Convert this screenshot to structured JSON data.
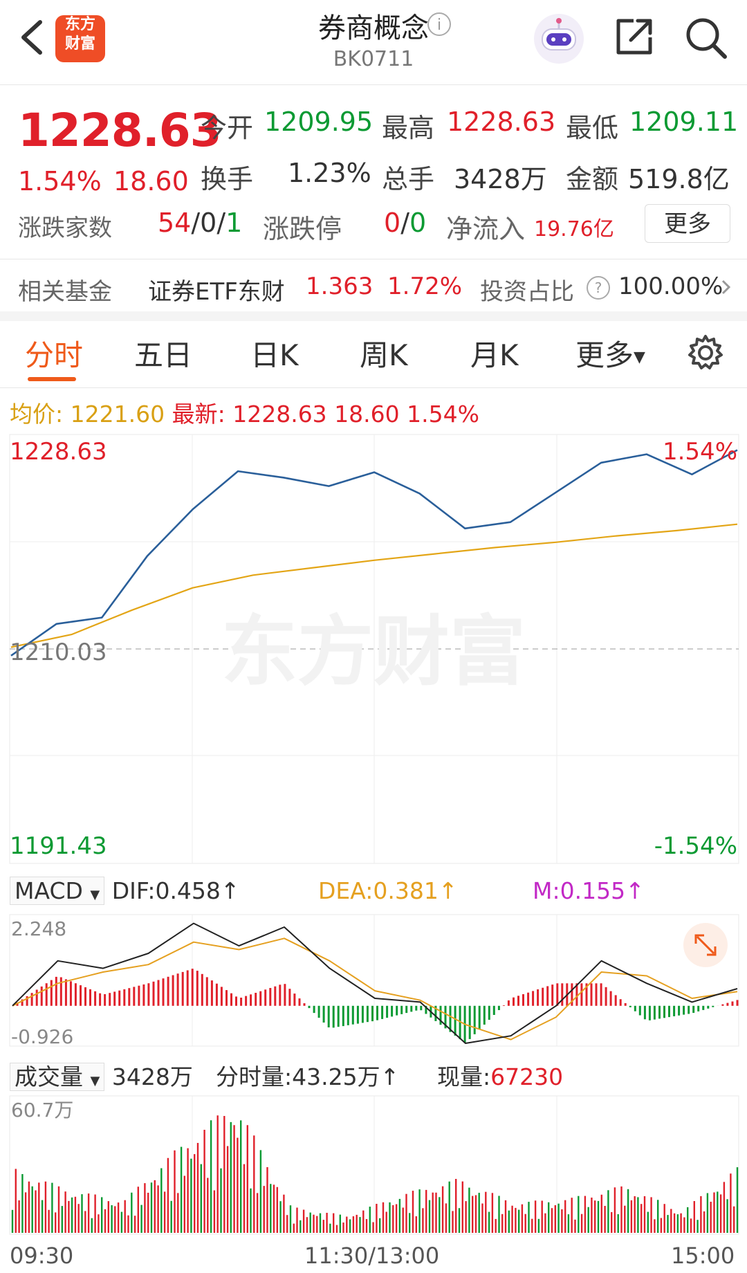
{
  "header": {
    "title": "券商概念",
    "code": "BK0711",
    "logo_text": [
      "东方",
      "财富"
    ],
    "icons": {
      "back": "chevron-left-icon",
      "info": "info-icon",
      "robot": "robot-assistant-icon",
      "share": "share-icon",
      "search": "search-icon"
    }
  },
  "quote": {
    "price": "1228.63",
    "change_pct": "1.54%",
    "change_abs": "18.60",
    "open_label": "今开",
    "open": "1209.95",
    "high_label": "最高",
    "high": "1228.63",
    "low_label": "最低",
    "low": "1209.11",
    "turnover_label": "换手",
    "turnover": "1.23%",
    "volume_label": "总手",
    "volume": "3428万",
    "amount_label": "金额",
    "amount": "519.8亿",
    "breadth_label": "涨跌家数",
    "breadth_up": "54",
    "breadth_flat": "0",
    "breadth_down": "1",
    "limit_label": "涨跌停",
    "limit_up": "0",
    "limit_down": "0",
    "netflow_label": "净流入",
    "netflow": "19.76亿",
    "more_label": "更多"
  },
  "fund": {
    "label": "相关基金",
    "name": "证券ETF东财",
    "price": "1.363",
    "pct": "1.72%",
    "ratio_label": "投资占比",
    "ratio": "100.00%"
  },
  "tabs": [
    {
      "label": "分时"
    },
    {
      "label": "五日"
    },
    {
      "label": "日K"
    },
    {
      "label": "周K"
    },
    {
      "label": "月K"
    },
    {
      "label": "更多"
    }
  ],
  "price_legend": {
    "avg_label": "均价:",
    "avg": "1221.60",
    "latest_label": "最新:",
    "latest": "1228.63",
    "chg": "18.60",
    "pct": "1.54%"
  },
  "price_axis": {
    "top": "1228.63",
    "mid": "1210.03",
    "bottom": "1191.43",
    "top_pct": "1.54%",
    "bottom_pct": "-1.54%"
  },
  "watermark": "东方财富",
  "macd_legend": {
    "name": "MACD",
    "dif": "DIF:0.458",
    "dea": "DEA:0.381",
    "m": "M:0.155",
    "axis_top": "2.248",
    "axis_bottom": "-0.926"
  },
  "volume_legend": {
    "name": "成交量",
    "total": "3428万",
    "tick_label": "分时量:",
    "tick": "43.25万",
    "now_label": "现量:",
    "now": "67230",
    "axis_top": "60.7万"
  },
  "time_axis": {
    "start": "09:30",
    "mid": "11:30/13:00",
    "end": "15:00"
  },
  "colors": {
    "up": "#e0202a",
    "down": "#0c9a33",
    "price_line": "#2a5f9a",
    "avg_line": "#e3a516",
    "dea": "#e5a020",
    "m": "#c229c6",
    "accent": "#ef5a1a"
  },
  "chart_data": [
    {
      "type": "line",
      "title": "",
      "ylim": [
        1191.43,
        1228.63
      ],
      "prev_close": 1210.03,
      "x": [
        "09:30",
        "11:30/13:00",
        "15:00"
      ],
      "series": [
        {
          "name": "均价",
          "values": [
            1210.0,
            1211.2,
            1213.5,
            1215.6,
            1216.8,
            1217.5,
            1218.2,
            1218.8,
            1219.4,
            1219.9,
            1220.5,
            1221.0,
            1221.6
          ]
        },
        {
          "values": [
            1209.2,
            1212.2,
            1212.8,
            1218.6,
            1223.0,
            1226.6,
            1226.0,
            1225.2,
            1226.5,
            1224.5,
            1221.2,
            1221.8,
            1224.6,
            1227.4,
            1228.2,
            1226.3,
            1228.6
          ]
        }
      ]
    },
    {
      "type": "line",
      "title": "",
      "ylim": [
        -0.926,
        2.248
      ],
      "series": [
        {
          "name": "DIF",
          "values": [
            0.0,
            1.2,
            1.0,
            1.4,
            2.2,
            1.6,
            2.1,
            1.0,
            0.2,
            0.1,
            -1.0,
            -0.8,
            0.0,
            1.2,
            0.6,
            0.1,
            0.458
          ]
        },
        {
          "name": "DEA",
          "values": [
            0.0,
            0.6,
            0.9,
            1.1,
            1.7,
            1.5,
            1.8,
            1.2,
            0.4,
            0.15,
            -0.5,
            -0.9,
            -0.3,
            0.9,
            0.8,
            0.2,
            0.381
          ]
        },
        {
          "name": "M",
          "values": [
            0.0,
            0.8,
            0.3,
            0.6,
            1.0,
            0.2,
            0.6,
            -0.6,
            -0.4,
            -0.1,
            -1.0,
            0.2,
            0.6,
            0.6,
            -0.4,
            -0.2,
            0.155
          ]
        }
      ]
    },
    {
      "type": "bar",
      "title": "",
      "ylim": [
        0,
        60.7
      ],
      "series": [
        {
          "name": "成交量",
          "values": [
            30,
            20,
            15,
            40,
            60.7,
            12,
            8,
            18,
            25,
            14,
            16,
            22,
            10,
            30
          ]
        }
      ]
    }
  ]
}
